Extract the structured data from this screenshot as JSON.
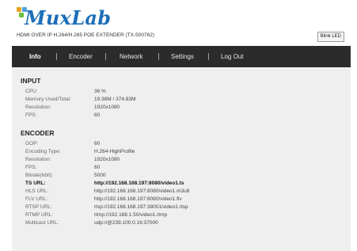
{
  "brand": {
    "name": "MuxLab",
    "color": "#1d6fb8",
    "dot_colors": [
      "#e8a020",
      "#4fa3e0",
      "#6cbf3a"
    ]
  },
  "device_title": "HDMI OVER IP H.264/H.265 POE EXTENDER (TX-500762)",
  "blink_led_label": "Blink LED",
  "nav": {
    "items": [
      {
        "label": "Info",
        "active": true
      },
      {
        "label": "Encoder",
        "active": false
      },
      {
        "label": "Network",
        "active": false
      },
      {
        "label": "Settings",
        "active": false
      },
      {
        "label": "Log Out",
        "active": false
      }
    ]
  },
  "input": {
    "title": "INPUT",
    "rows": [
      {
        "label": "CPU:",
        "value": "36 %"
      },
      {
        "label": "Memory Used/Total:",
        "value": "19.38M / 374.83M"
      },
      {
        "label": "Resolution:",
        "value": "1920x1080"
      },
      {
        "label": "FPS:",
        "value": "60"
      }
    ]
  },
  "encoder": {
    "title": "ENCODER",
    "rows": [
      {
        "label": "GOP:",
        "value": "60"
      },
      {
        "label": "Encoding Type:",
        "value": "H.264-HighProfile"
      },
      {
        "label": "Resolution:",
        "value": "1920x1080"
      },
      {
        "label": "FPS:",
        "value": "60"
      },
      {
        "label": "Bitrate(kbit):",
        "value": "5000"
      },
      {
        "label": "TS URL:",
        "value": "http://192.168.168.197:8080/video1.ts"
      },
      {
        "label": "HLS URL:",
        "value": "http://192.168.168.197:8080/video1.m3u8"
      },
      {
        "label": "FLV URL:",
        "value": "http://192.168.168.197:8080/video1.flv"
      },
      {
        "label": "RTSP URL:",
        "value": "rtsp://192.168.168.197:38001/video1.rtsp"
      },
      {
        "label": "RTMP URL:",
        "value": "rtmp://192.168.1.50/video1.rtmp"
      },
      {
        "label": "Multicast URL:",
        "value": "udp://@239.100.0.16:37000"
      }
    ]
  }
}
